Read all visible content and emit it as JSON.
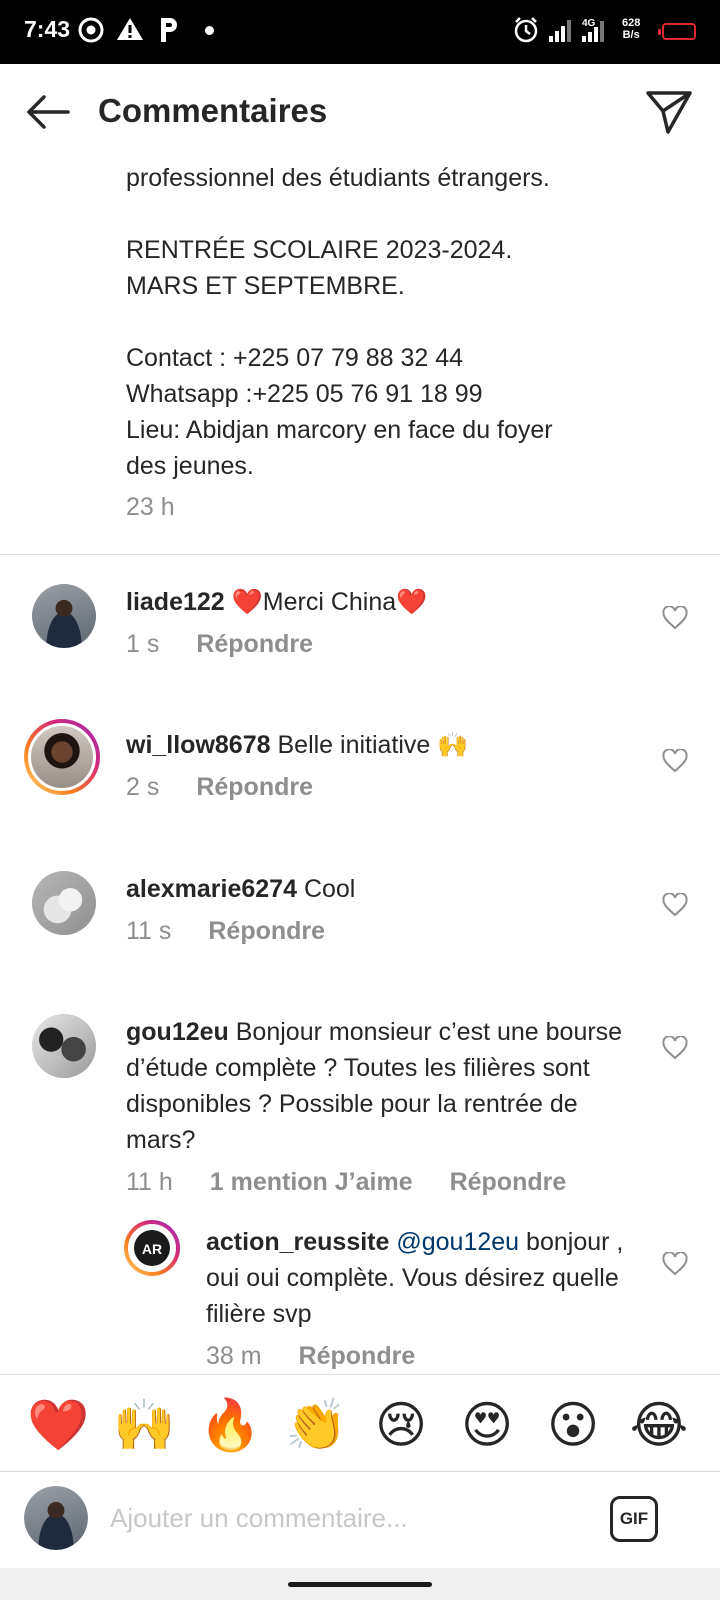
{
  "status_bar": {
    "time": "7:43",
    "network_speed_value": "628",
    "network_speed_unit": "B/s",
    "network_type": "4G"
  },
  "header": {
    "title": "Commentaires"
  },
  "caption": {
    "lines": [
      "professionnel des étudiants étrangers.",
      "",
      "RENTRÉE SCOLAIRE 2023-2024.",
      "MARS ET SEPTEMBRE.",
      "",
      "Contact : +225 07 79 88 32 44",
      "Whatsapp :+225 05 76 91 18 99",
      "Lieu: Abidjan marcory en face du foyer",
      "des jeunes."
    ],
    "time": "23 h"
  },
  "comments": [
    {
      "username": "liade122",
      "text_parts": [
        "❤️",
        "Merci China",
        "❤️"
      ],
      "time": "1 s",
      "reply_label": "Répondre"
    },
    {
      "username": "wi_llow8678",
      "text": "Belle initiative 🙌",
      "time": "2 s",
      "reply_label": "Répondre"
    },
    {
      "username": "alexmarie6274",
      "text": "Cool",
      "time": "11 s",
      "reply_label": "Répondre"
    },
    {
      "username": "gou12eu",
      "text": "Bonjour monsieur c’est une bourse d’étude complète ? Toutes les filières sont disponibles ? Possible pour la rentrée de mars?",
      "time": "11 h",
      "likes": "1 mention J’aime",
      "reply_label": "Répondre"
    }
  ],
  "reply": {
    "username": "action_reussite",
    "mention": "@gou12eu",
    "text": "bonjour , oui oui complète.  Vous désirez quelle filière svp",
    "time": "38 m",
    "reply_label": "Répondre",
    "avatar_text": "AR"
  },
  "emoji_bar": [
    "❤️",
    "🙌",
    "🔥",
    "👏",
    "😢",
    "😍",
    "😮",
    "😂"
  ],
  "composer": {
    "placeholder": "Ajouter un commentaire...",
    "gif_label": "GIF"
  },
  "colors": {
    "primary_text": "#262626",
    "secondary_text": "#8e8e8e",
    "mention": "#00376b",
    "divider": "#dbdbdb",
    "battery_low": "#e0282f"
  }
}
